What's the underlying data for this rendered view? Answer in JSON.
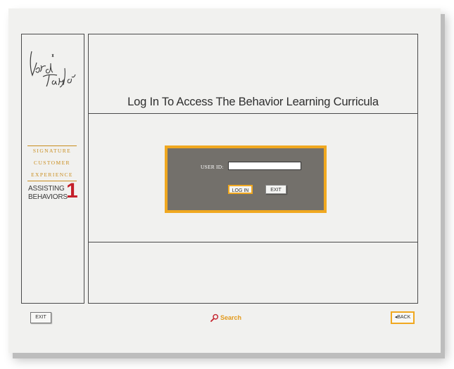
{
  "sidebar": {
    "logo_alt": "Lord & Taylor",
    "signature": [
      "SIGNATURE",
      "CUSTOMER",
      "EXPERIENCE"
    ],
    "module_title": [
      "ASSISTING",
      "BEHAVIORS"
    ],
    "module_number": "1"
  },
  "main": {
    "title": "Log In To Access The Behavior Learning Curricula",
    "login": {
      "user_id_label": "USER ID:",
      "user_id_value": "",
      "login_button": "LOG IN",
      "exit_button": "EXIT"
    }
  },
  "footer": {
    "exit_button": "EXIT",
    "search_label": "Search",
    "back_label": "BACK"
  },
  "colors": {
    "accent": "#f0a820",
    "gold_text": "#c98d1e",
    "red": "#c4202b",
    "panel": "#73706b",
    "background": "#f1f1ef"
  }
}
